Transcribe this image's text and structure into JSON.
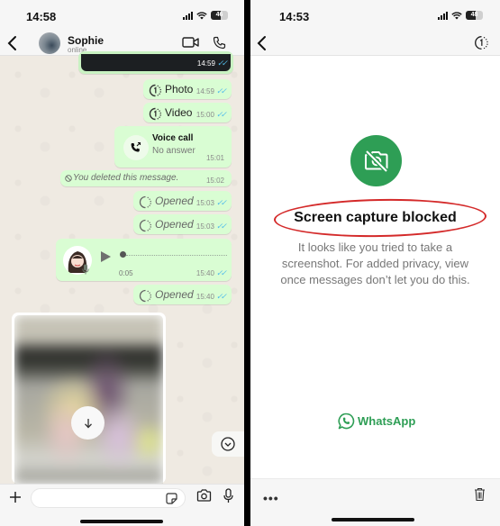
{
  "left_screen": {
    "status_bar": {
      "time": "14:58",
      "battery": "46"
    },
    "header": {
      "contact_name": "Sophie",
      "contact_status": "online",
      "icons": [
        "back-chevron-icon",
        "video-call-icon",
        "phone-icon"
      ]
    },
    "messages": [
      {
        "type": "image-partial",
        "time": "14:59",
        "read": true
      },
      {
        "type": "view-once",
        "label": "Photo",
        "time": "14:59",
        "read": true
      },
      {
        "type": "view-once",
        "label": "Video",
        "time": "15:00",
        "read": true
      },
      {
        "type": "voice-call",
        "title": "Voice call",
        "subtitle": "No answer",
        "time": "15:01"
      },
      {
        "type": "deleted",
        "text": "You deleted this message.",
        "time": "15:02"
      },
      {
        "type": "view-once-opened",
        "label": "Opened",
        "time": "15:03",
        "read": true
      },
      {
        "type": "view-once-opened",
        "label": "Opened",
        "time": "15:03",
        "read": true
      },
      {
        "type": "voice-note",
        "duration": "0:05",
        "time": "15:40",
        "read": true
      },
      {
        "type": "view-once-opened",
        "label": "Opened",
        "time": "15:40",
        "read": true
      },
      {
        "type": "image-download"
      }
    ],
    "compose": {
      "placeholder": "",
      "icons": [
        "plus-icon",
        "sticker-icon",
        "camera-icon",
        "microphone-icon"
      ]
    }
  },
  "right_screen": {
    "status_bar": {
      "time": "14:53",
      "battery": "48"
    },
    "header": {
      "icons": [
        "back-chevron-icon",
        "view-once-icon"
      ]
    },
    "notice": {
      "title": "Screen capture blocked",
      "body": "It looks like you tried to take a screenshot. For added privacy, view once messages don’t let you do this."
    },
    "brand": "WhatsApp",
    "footer": {
      "more_label": "•••"
    },
    "colors": {
      "accent": "#2e9e55",
      "annotation": "#d42a2a"
    }
  },
  "colors": {
    "bubble_out": "#d9fdd3",
    "chat_bg": "#efeae2",
    "read_ticks": "#53bdeb"
  }
}
